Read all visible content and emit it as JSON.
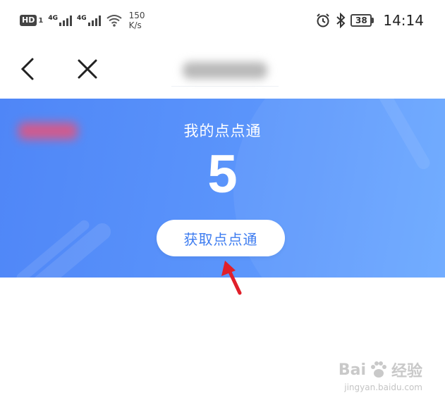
{
  "status_bar": {
    "hd_label": "HD",
    "hd_sub": "1",
    "network1": "4G",
    "network2": "4G",
    "speed_value": "150",
    "speed_unit": "K/s",
    "battery": "38",
    "time": "14:14"
  },
  "nav": {
    "back_icon": "chevron-left-icon",
    "close_icon": "close-icon"
  },
  "banner": {
    "title": "我的点点通",
    "count": "5",
    "button_label": "获取点点通",
    "colors": {
      "gradient_start": "#4f86f7",
      "gradient_end": "#6aa8ff",
      "button_text": "#3d7cf0"
    }
  },
  "annotation": {
    "arrow_color": "#e0202a"
  },
  "watermark": {
    "brand_a": "Bai",
    "brand_b": "经验",
    "url": "jingyan.baidu.com"
  }
}
